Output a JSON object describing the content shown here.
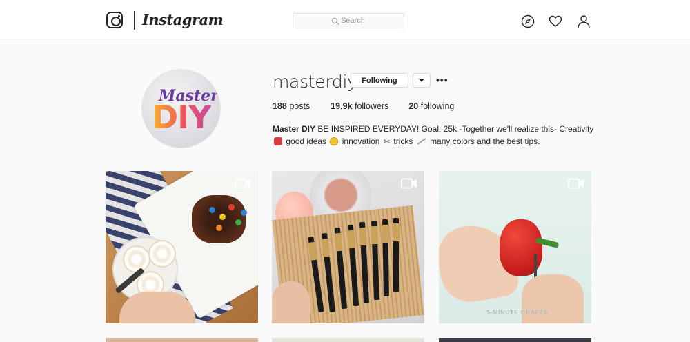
{
  "app": {
    "wordmark": "Instagram"
  },
  "search": {
    "placeholder": "Search"
  },
  "nav": {
    "icons": [
      "compass-icon",
      "heart-icon",
      "user-icon"
    ]
  },
  "profile": {
    "username": "masterdiy",
    "follow_label": "Following",
    "more_label": "•••",
    "avatar": {
      "line1": "Master",
      "line2": "DIY"
    },
    "stats": {
      "posts_count": "188",
      "posts_label": "posts",
      "followers_count": "19.9k",
      "followers_label": "followers",
      "following_count": "20",
      "following_label": "following"
    },
    "bio": {
      "name": "Master DIY",
      "line1_rest": "BE INSPIRED EVERYDAY! Goal: 25k -Together we'll realize this- Creativity",
      "good_ideas": "good ideas",
      "innovation": "innovation",
      "scissors": "✄",
      "tricks": "tricks",
      "tail": "many colors and the best tips."
    }
  },
  "posts": {
    "watermark": "5-MINUTE CRAFTS"
  },
  "colors": {
    "border": "#dbdbdb",
    "text": "#262626",
    "background": "#fafafa"
  }
}
